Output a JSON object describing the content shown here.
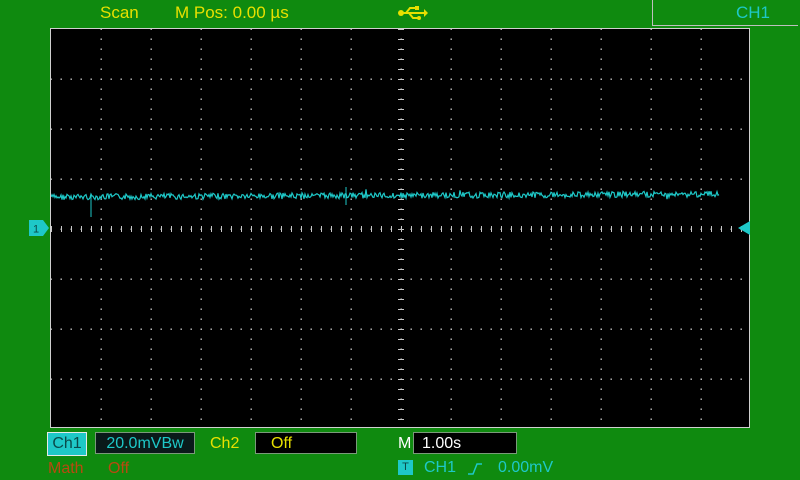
{
  "header": {
    "mode": "Scan",
    "m_pos": "M Pos: 0.00 µs",
    "usb_icon": "usb-icon",
    "menu_channel": "CH1"
  },
  "screen": {
    "trace_color": "#1ec8c8",
    "ch1_marker": "1",
    "trigger_level_icon": "trigger-level-arrow-icon"
  },
  "footer": {
    "ch1_label": "Ch1",
    "ch1_scale": "20.0mVBw",
    "ch2_label": "Ch2",
    "ch2_value": "Off",
    "timebase_label": "M",
    "timebase_value": "1.00s",
    "math_label": "Math",
    "math_value": "Off",
    "trigger_badge": "T",
    "trigger_source": "CH1",
    "trigger_slope_icon": "rising-edge-icon",
    "trigger_level": "0.00mV"
  },
  "colors": {
    "background": "#0f8a0f",
    "yellow": "#e8e000",
    "cyan": "#1ec8c8",
    "math": "#b84a10"
  }
}
